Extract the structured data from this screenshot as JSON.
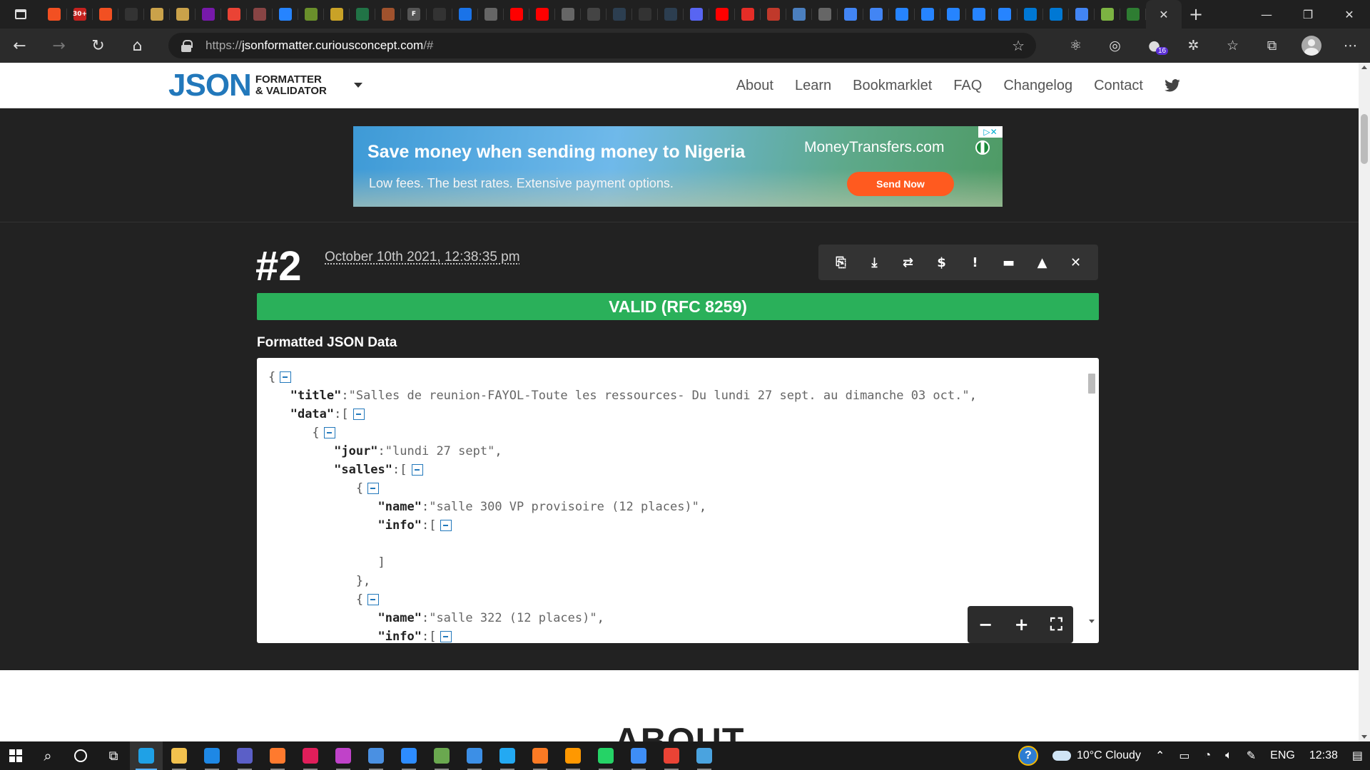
{
  "browser": {
    "tabs": [
      {
        "icon": "microsoft-icon",
        "color": "#f25022"
      },
      {
        "icon": "gmail-counter-icon",
        "color": "#c5221f",
        "label": "30+"
      },
      {
        "icon": "microsoft-icon",
        "color": "#f25022"
      },
      {
        "icon": "github-icon",
        "color": "#333333"
      },
      {
        "icon": "duolingo-icon",
        "color": "#caa24a"
      },
      {
        "icon": "duolingo-icon",
        "color": "#caa24a"
      },
      {
        "icon": "onenote-icon",
        "color": "#7719aa"
      },
      {
        "icon": "gmail-icon",
        "color": "#ea4335"
      },
      {
        "icon": "gmail-icon",
        "color": "#884444"
      },
      {
        "icon": "jira-icon",
        "color": "#2684ff"
      },
      {
        "icon": "game-icon",
        "color": "#6a8f2b"
      },
      {
        "icon": "chart-icon",
        "color": "#c9a227"
      },
      {
        "icon": "excel-icon",
        "color": "#217346"
      },
      {
        "icon": "download-icon",
        "color": "#a0522d"
      },
      {
        "icon": "font-icon",
        "color": "#555555",
        "label": "F"
      },
      {
        "icon": "circle-icon",
        "color": "#333333"
      },
      {
        "icon": "power-icon",
        "color": "#1a73e8"
      },
      {
        "icon": "document-icon",
        "color": "#666666"
      },
      {
        "icon": "youtube-icon",
        "color": "#ff0000"
      },
      {
        "icon": "youtube-icon",
        "color": "#ff0000"
      },
      {
        "icon": "document-icon",
        "color": "#666666"
      },
      {
        "icon": "translate-icon",
        "color": "#444444"
      },
      {
        "icon": "grid-icon",
        "color": "#2c3e50"
      },
      {
        "icon": "video-icon",
        "color": "#333333"
      },
      {
        "icon": "grid-icon",
        "color": "#2c3e50"
      },
      {
        "icon": "discord-icon",
        "color": "#5865f2"
      },
      {
        "icon": "youtube-icon",
        "color": "#ff0000"
      },
      {
        "icon": "play-icon",
        "color": "#e52d27"
      },
      {
        "icon": "app-icon",
        "color": "#c0392b"
      },
      {
        "icon": "trello-icon",
        "color": "#4b7fbf"
      },
      {
        "icon": "document-icon",
        "color": "#666666"
      },
      {
        "icon": "google-docs-icon",
        "color": "#4285f4"
      },
      {
        "icon": "google-docs-icon",
        "color": "#4285f4"
      },
      {
        "icon": "confluence-icon",
        "color": "#2684ff"
      },
      {
        "icon": "confluence-icon",
        "color": "#2684ff"
      },
      {
        "icon": "confluence-icon",
        "color": "#2684ff"
      },
      {
        "icon": "confluence-icon",
        "color": "#2684ff"
      },
      {
        "icon": "confluence-icon",
        "color": "#2684ff"
      },
      {
        "icon": "azure-icon",
        "color": "#0078d4"
      },
      {
        "icon": "azure-icon",
        "color": "#0078d4"
      },
      {
        "icon": "google-docs-icon",
        "color": "#4285f4"
      },
      {
        "icon": "dots-icon",
        "color": "#7cb342"
      },
      {
        "icon": "extension-icon",
        "color": "#2e7d32"
      }
    ],
    "active_tab_close": "✕",
    "new_tab": "+",
    "window_controls": {
      "minimize": "—",
      "maximize": "❐",
      "close": "✕"
    },
    "url_scheme": "https://",
    "url_host": "jsonformatter.curiousconcept.com",
    "url_rest": "/#",
    "extension_badge": "16"
  },
  "site": {
    "logo_big": "JSON",
    "logo_line1": "FORMATTER",
    "logo_line2": "& VALIDATOR",
    "nav": [
      "About",
      "Learn",
      "Bookmarklet",
      "FAQ",
      "Changelog",
      "Contact"
    ]
  },
  "ad": {
    "headline": "Save money when sending money to Nigeria",
    "subline": "Low fees. The best rates. Extensive payment options.",
    "brand": "MoneyTransfers.com",
    "cta": "Send Now"
  },
  "result": {
    "number": "#2",
    "timestamp": "October 10th 2021, 12:38:35 pm",
    "actions": [
      "copy-icon",
      "download-icon",
      "refresh-icon",
      "dollar-icon",
      "alert-icon",
      "collapse-icon",
      "expand-icon",
      "close-icon"
    ],
    "status": "VALID (RFC 8259)",
    "section_label": "Formatted JSON Data",
    "json": {
      "title_key": "\"title\"",
      "title_val": "\"Salles de reunion-FAYOL-Toute les ressources- Du lundi 27 sept. au dimanche 03 oct.\"",
      "data_key": "\"data\"",
      "jour_key": "\"jour\"",
      "jour_val": "\"lundi 27 sept\"",
      "salles_key": "\"salles\"",
      "name_key": "\"name\"",
      "name1_val": "\"salle 300 VP provisoire (12 places)\"",
      "info_key": "\"info\"",
      "name2_val": "\"salle 322 (12 places)\""
    },
    "zoom": {
      "out": "−",
      "in": "+",
      "full": "⛶"
    }
  },
  "about_heading": "ABOUT",
  "taskbar": {
    "apps": [
      {
        "icon": "edge-icon",
        "color": "#1fa1e6",
        "state": "active"
      },
      {
        "icon": "file-explorer-icon",
        "color": "#f2c14e",
        "state": "run"
      },
      {
        "icon": "mail-icon",
        "color": "#1e88e5",
        "state": "run"
      },
      {
        "icon": "teams-icon",
        "color": "#5b5fc7",
        "state": "run"
      },
      {
        "icon": "app-icon",
        "color": "#ff7a2e",
        "state": "run"
      },
      {
        "icon": "slack-icon",
        "color": "#e01e5a",
        "state": "run"
      },
      {
        "icon": "jetbrains-icon",
        "color": "#c042c9",
        "state": "run"
      },
      {
        "icon": "network-icon",
        "color": "#4a90e2",
        "state": "run"
      },
      {
        "icon": "zoom-icon",
        "color": "#2d8cff",
        "state": "run"
      },
      {
        "icon": "phone-link-icon",
        "color": "#6aa84f",
        "state": "run"
      },
      {
        "icon": "forticlient-icon",
        "color": "#3c8fe6",
        "state": "run"
      },
      {
        "icon": "vscode-icon",
        "color": "#23a9f2",
        "state": "run"
      },
      {
        "icon": "xampp-icon",
        "color": "#fb7a24",
        "state": "run"
      },
      {
        "icon": "sublime-icon",
        "color": "#ff9800",
        "state": "run"
      },
      {
        "icon": "whatsapp-icon",
        "color": "#25d366",
        "state": "run"
      },
      {
        "icon": "paint-icon",
        "color": "#3e8ef7",
        "state": "run"
      },
      {
        "icon": "chrome-icon",
        "color": "#ea4335",
        "state": "run"
      },
      {
        "icon": "photos-icon",
        "color": "#4aa3df",
        "state": "run"
      }
    ],
    "weather": "10°C  Cloudy",
    "lang": "ENG",
    "time": "12:38"
  }
}
